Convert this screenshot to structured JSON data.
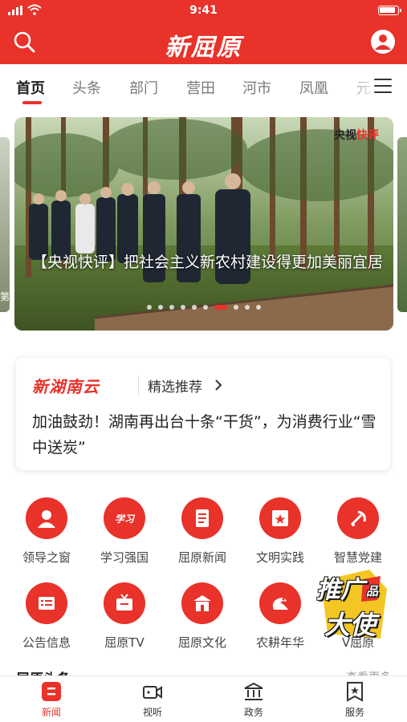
{
  "status_bar": {
    "time": "9:41"
  },
  "header": {
    "title": "新屈原",
    "search_icon": "search-icon",
    "profile_icon": "user-profile-icon",
    "accent_color": "#e8322a"
  },
  "tabs": {
    "items": [
      {
        "label": "首页",
        "active": true
      },
      {
        "label": "头条"
      },
      {
        "label": "部门"
      },
      {
        "label": "营田"
      },
      {
        "label": "河市"
      },
      {
        "label": "凤凰"
      },
      {
        "label": "元"
      }
    ],
    "menu_icon": "hamburger-menu-icon"
  },
  "carousel": {
    "watermark_prefix": "央视",
    "watermark_suffix": "快评",
    "caption": "【央视快评】把社会主义新农村建设得更加美丽宜居",
    "peek_left_char": "第",
    "slide_count": 10,
    "active_index": 6
  },
  "recommendation": {
    "source_logo": "新湖南云",
    "label": "精选推荐",
    "headline": "加油鼓劲！湖南再出台十条“干货”，为消费行业“雪中送炭”"
  },
  "grid": {
    "items": [
      {
        "label": "领导之窗",
        "icon": "leader-avatar-icon"
      },
      {
        "label": "学习强国",
        "icon": "study-logo-icon"
      },
      {
        "label": "屈原新闻",
        "icon": "news-document-icon"
      },
      {
        "label": "文明实践",
        "icon": "civilization-banner-icon"
      },
      {
        "label": "智慧党建",
        "icon": "party-emblem-icon"
      },
      {
        "label": "公告信息",
        "icon": "notice-board-icon"
      },
      {
        "label": "屈原TV",
        "icon": "tv-icon"
      },
      {
        "label": "屈原文化",
        "icon": "culture-building-icon"
      },
      {
        "label": "农耕年华",
        "icon": "dragon-icon"
      },
      {
        "label": "V屈原",
        "icon": "v-badge-icon"
      }
    ]
  },
  "promo_badge": {
    "line1": "推广",
    "line2": "大使",
    "tag": "品"
  },
  "section_peek": {
    "title": "屈原头条",
    "more": "查看更多"
  },
  "bottom_nav": {
    "items": [
      {
        "label": "新闻",
        "icon": "news-icon",
        "active": true
      },
      {
        "label": "视听",
        "icon": "video-camera-icon"
      },
      {
        "label": "政务",
        "icon": "government-building-icon"
      },
      {
        "label": "服务",
        "icon": "service-badge-icon"
      }
    ]
  }
}
